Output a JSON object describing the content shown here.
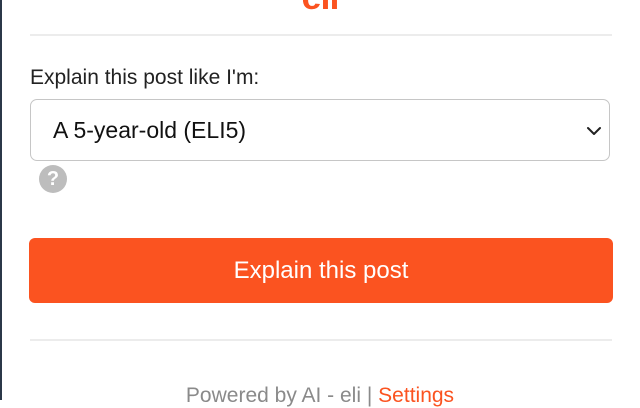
{
  "header": {
    "logo_text": "eli",
    "accent_color": "#fb5320"
  },
  "form": {
    "prompt_label": "Explain this post like I'm:",
    "level_select": {
      "selected": "A 5-year-old (ELI5)",
      "icon": "chevron-down-icon"
    },
    "help": {
      "icon": "question-circle-icon",
      "glyph": "?"
    },
    "submit_label": "Explain this post"
  },
  "footer": {
    "powered_text": "Powered by AI - eli",
    "separator": "|",
    "settings_label": "Settings"
  }
}
